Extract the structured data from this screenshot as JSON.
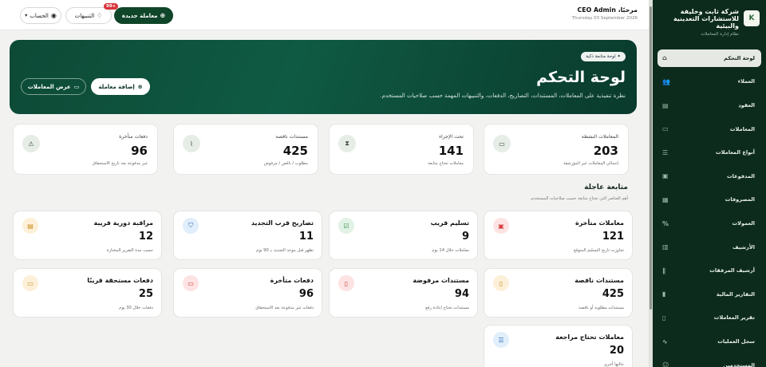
{
  "sidebar": {
    "brand_name_line1": "شركة ثابت وخليفة",
    "brand_name_line2": "للاستشارات التعدينية والبيئية",
    "brand_subtitle": "نظام إدارة المعاملات",
    "brand_logo_text": "K",
    "items": [
      {
        "label": "لوحة التحكم",
        "icon": "home-icon",
        "glyph": "⌂",
        "active": true
      },
      {
        "label": "العملاء",
        "icon": "users-icon",
        "glyph": "👥",
        "active": false
      },
      {
        "label": "العقود",
        "icon": "document-icon",
        "glyph": "▤",
        "active": false
      },
      {
        "label": "المعاملات",
        "icon": "folder-icon",
        "glyph": "▭",
        "active": false
      },
      {
        "label": "أنواع المعاملات",
        "icon": "list-icon",
        "glyph": "☰",
        "active": false
      },
      {
        "label": "المدفوعات",
        "icon": "wallet-icon",
        "glyph": "▣",
        "active": false
      },
      {
        "label": "المصروفات",
        "icon": "receipt-icon",
        "glyph": "▦",
        "active": false
      },
      {
        "label": "العمولات",
        "icon": "percent-icon",
        "glyph": "%",
        "active": false
      },
      {
        "label": "الأرشيف",
        "icon": "archive-icon",
        "glyph": "▥",
        "active": false
      },
      {
        "label": "أرشيف المرفقات",
        "icon": "paperclip-icon",
        "glyph": "∥",
        "active": false
      },
      {
        "label": "التقارير المالية",
        "icon": "chart-icon",
        "glyph": "▮",
        "active": false
      },
      {
        "label": "تقرير المعاملات",
        "icon": "report-icon",
        "glyph": "▯",
        "active": false
      },
      {
        "label": "سجل العمليات",
        "icon": "activity-icon",
        "glyph": "∿",
        "active": false
      },
      {
        "label": "المستخدمين",
        "icon": "user-cog-icon",
        "glyph": "☺",
        "active": false
      }
    ]
  },
  "topbar": {
    "account_label": "الحساب",
    "notifications_label": "التنبيهات",
    "notifications_badge": "99+",
    "new_transaction_label": "معاملة جديدة",
    "greeting": "مرحبًا، CEO Admin",
    "date": "Thursday 03 September 2026"
  },
  "hero": {
    "badge": "لوحة متابعة ذكية",
    "title": "لوحة التحكم",
    "description": "نظرة تنفيذية على المعاملات، المستندات، التصاريح، الدفعات، والتنبيهات المهمة حسب صلاحيات المستخدم.",
    "add_button": "إضافة معاملة",
    "view_button": "عرض المعاملات"
  },
  "stats": [
    {
      "title": "المعاملات النشطة",
      "value": "203",
      "sub": "إجمالي المعاملات غير المؤرشفة",
      "icon": "folder-icon",
      "glyph": "▭"
    },
    {
      "title": "تحت الإجراء",
      "value": "141",
      "sub": "معاملات تحتاج متابعة",
      "icon": "hourglass-icon",
      "glyph": "⧗"
    },
    {
      "title": "مستندات ناقصة",
      "value": "425",
      "sub": "مطلوب / ناقص / مرفوض",
      "icon": "paperclip-icon",
      "glyph": "⌇"
    },
    {
      "title": "دفعات متأخرة",
      "value": "96",
      "sub": "غير مدفوعة بعد تاريخ الاستحقاق",
      "icon": "warning-icon",
      "glyph": "⚠"
    }
  ],
  "urgent": {
    "title": "متابعة عاجلة",
    "subtitle": "أهم العناصر التي تحتاج متابعة حسب صلاحيات المستخدم.",
    "cards": [
      {
        "title": "معاملات متأخرة",
        "value": "121",
        "sub": "تجاوزت تاريخ التسليم المتوقع",
        "icon": "calendar-alert-icon",
        "glyph": "▣",
        "bg": "#fde3e3",
        "fg": "#d23c3c"
      },
      {
        "title": "تسليم قريب",
        "value": "9",
        "sub": "معاملات خلال 14 يوم",
        "icon": "calendar-check-icon",
        "glyph": "☑",
        "bg": "#e2f2e6",
        "fg": "#2f8a47"
      },
      {
        "title": "تصاريح قرب التجديد",
        "value": "11",
        "sub": "تظهر قبل موعد التجديد بـ 90 يوم",
        "icon": "shield-icon",
        "glyph": "⛉",
        "bg": "#e1eefb",
        "fg": "#2d6fb8"
      },
      {
        "title": "مراقبة دورية قريبة",
        "value": "12",
        "sub": "حسب مدة التقرير المختارة",
        "icon": "monitor-icon",
        "glyph": "▤",
        "bg": "#fdf0d8",
        "fg": "#c98a1a"
      },
      {
        "title": "مستندات ناقصة",
        "value": "425",
        "sub": "مستندات مطلوبة أو ناقصة",
        "icon": "file-alert-icon",
        "glyph": "▯",
        "bg": "#fdf0d8",
        "fg": "#c98a1a"
      },
      {
        "title": "مستندات مرفوضة",
        "value": "94",
        "sub": "مستندات تحتاج إعادة رفع",
        "icon": "file-x-icon",
        "glyph": "▯",
        "bg": "#fde3e3",
        "fg": "#d23c3c"
      },
      {
        "title": "دفعات متأخرة",
        "value": "96",
        "sub": "دفعات غير مدفوعة بعد الاستحقاق",
        "icon": "cash-icon",
        "glyph": "▭",
        "bg": "#fde3e3",
        "fg": "#d23c3c"
      },
      {
        "title": "دفعات مستحقة قريبًا",
        "value": "25",
        "sub": "دفعات خلال 30 يوم",
        "icon": "card-icon",
        "glyph": "▭",
        "bg": "#fdf0d8",
        "fg": "#c98a1a"
      },
      {
        "title": "معاملات تحتاج مراجعة",
        "value": "20",
        "sub": "حالتها أخرى",
        "icon": "message-icon",
        "glyph": "☰",
        "bg": "#e1eefb",
        "fg": "#2d6fb8"
      }
    ]
  }
}
